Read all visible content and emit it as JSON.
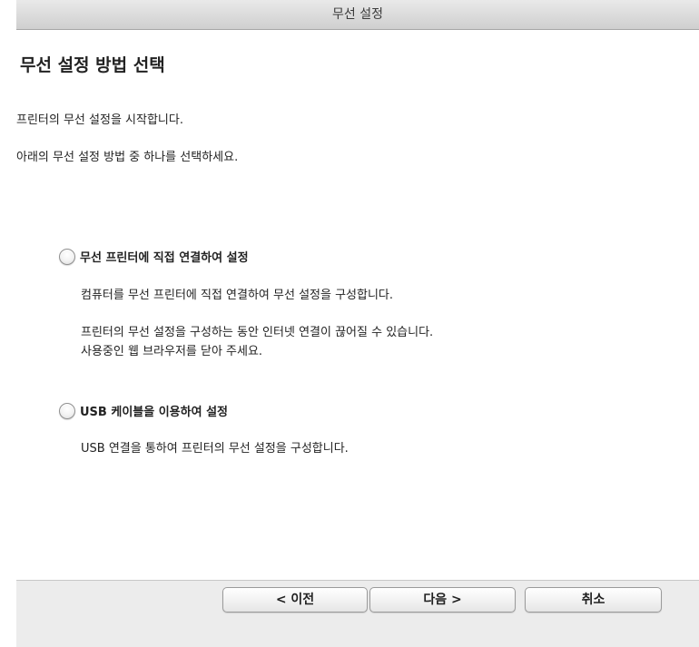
{
  "window": {
    "title": "무선 설정"
  },
  "page": {
    "heading": "무선 설정 방법 선택",
    "intro_lines": [
      "프린터의 무선 설정을 시작합니다.",
      "아래의 무선 설정 방법 중 하나를 선택하세요."
    ]
  },
  "options": [
    {
      "label": "무선 프린터에 직접 연결하여 설정",
      "selected": false,
      "description_lines": [
        "컴퓨터를 무선 프린터에 직접 연결하여 무선 설정을 구성합니다.",
        "프린터의 무선 설정을 구성하는 동안 인터넷 연결이 끊어질 수 있습니다.",
        "사용중인 웹 브라우저를 닫아 주세요."
      ]
    },
    {
      "label": "USB 케이블을 이용하여 설정",
      "selected": false,
      "description_lines": [
        "USB 연결을 통하여 프린터의 무선 설정을 구성합니다."
      ]
    }
  ],
  "footer": {
    "prev_label": "< 이전",
    "next_label": "다음 >",
    "cancel_label": "취소"
  }
}
